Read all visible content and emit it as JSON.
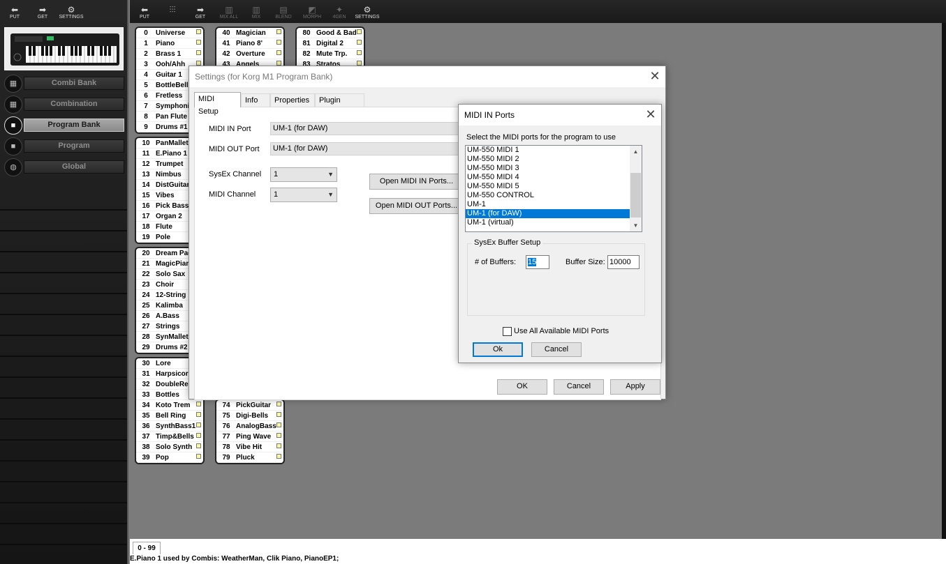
{
  "left_toolbar": {
    "put": "PUT",
    "get": "GET",
    "settings": "SETTINGS"
  },
  "top_toolbar": {
    "put": "PUT",
    "mix_icon": "sliders-icon",
    "get": "GET",
    "mix_all": "MIX ALL",
    "mix": "MIX",
    "blend": "BLEND",
    "morph": "MORPH",
    "4gen": "4GEN",
    "settings": "SETTINGS"
  },
  "nav": {
    "items": [
      {
        "label": "Combi Bank",
        "icon": "keyboard-grid-icon",
        "selected": false
      },
      {
        "label": "Combination",
        "icon": "keyboard-grid-icon",
        "selected": false
      },
      {
        "label": "Program Bank",
        "icon": "square-icon",
        "selected": true
      },
      {
        "label": "Program",
        "icon": "square-icon",
        "selected": false
      },
      {
        "label": "Global",
        "icon": "globe-icon",
        "selected": false
      }
    ]
  },
  "programs": {
    "col1": [
      [
        "0",
        "Universe"
      ],
      [
        "1",
        "Piano"
      ],
      [
        "2",
        "Brass 1"
      ],
      [
        "3",
        "Ooh/Ahh"
      ],
      [
        "4",
        "Guitar 1"
      ],
      [
        "5",
        "BottleBell"
      ],
      [
        "6",
        "Fretless"
      ],
      [
        "7",
        "Symphonic"
      ],
      [
        "8",
        "Pan Flute"
      ],
      [
        "9",
        "Drums #1"
      ],
      [
        "10",
        "PanMallet"
      ],
      [
        "11",
        "E.Piano 1"
      ],
      [
        "12",
        "Trumpet"
      ],
      [
        "13",
        "Nimbus"
      ],
      [
        "14",
        "DistGuitar"
      ],
      [
        "15",
        "Vibes"
      ],
      [
        "16",
        "Pick Bass"
      ],
      [
        "17",
        "Organ 2"
      ],
      [
        "18",
        "Flute"
      ],
      [
        "19",
        "Pole"
      ],
      [
        "20",
        "Dream Pad"
      ],
      [
        "21",
        "MagicPiano"
      ],
      [
        "22",
        "Solo Sax"
      ],
      [
        "23",
        "Choir"
      ],
      [
        "24",
        "12-String"
      ],
      [
        "25",
        "Kalimba"
      ],
      [
        "26",
        "A.Bass"
      ],
      [
        "27",
        "Strings"
      ],
      [
        "28",
        "SynMallet"
      ],
      [
        "29",
        "Drums #2"
      ],
      [
        "30",
        "Lore"
      ],
      [
        "31",
        "Harpsicord"
      ],
      [
        "32",
        "DoubleReed"
      ],
      [
        "33",
        "Bottles"
      ],
      [
        "34",
        "Koto Trem"
      ],
      [
        "35",
        "Bell Ring"
      ],
      [
        "36",
        "SynthBass1"
      ],
      [
        "37",
        "Timp&Bells"
      ],
      [
        "38",
        "Solo Synth"
      ],
      [
        "39",
        "Pop"
      ]
    ],
    "col2_top": [
      [
        "40",
        "Magician"
      ],
      [
        "41",
        "Piano 8'"
      ],
      [
        "42",
        "Overture"
      ],
      [
        "43",
        "Angels"
      ]
    ],
    "col2_bottom": [
      [
        "74",
        "PickGuitar"
      ],
      [
        "75",
        "Digi-Bells"
      ],
      [
        "76",
        "AnalogBass"
      ],
      [
        "77",
        "Ping Wave"
      ],
      [
        "78",
        "Vibe Hit"
      ],
      [
        "79",
        "Pluck"
      ]
    ],
    "col3_top": [
      [
        "80",
        "Good & Bad"
      ],
      [
        "81",
        "Digital 2"
      ],
      [
        "82",
        "Mute Trp."
      ],
      [
        "83",
        "Stratos"
      ]
    ]
  },
  "status": {
    "range_tab": "0 - 99",
    "message": "E.Piano 1 used by Combis: WeatherMan, Clik Piano, PianoEP1;"
  },
  "settings_dialog": {
    "title": "Settings (for Korg M1 Program Bank)",
    "tabs": [
      "MIDI Setup",
      "Info",
      "Properties",
      "Plugin Setup"
    ],
    "midi_in_port_label": "MIDI IN Port",
    "midi_in_port_value": "UM-1 (for DAW)",
    "midi_out_port_label": "MIDI OUT Port",
    "midi_out_port_value": "UM-1 (for DAW)",
    "sysex_channel_label": "SysEx Channel",
    "sysex_channel_value": "1",
    "midi_channel_label": "MIDI Channel",
    "midi_channel_value": "1",
    "open_in_button": "Open MIDI IN Ports...",
    "open_out_button": "Open MIDI OUT Ports...",
    "ok": "OK",
    "cancel": "Cancel",
    "apply": "Apply"
  },
  "ports_dialog": {
    "title": "MIDI IN Ports",
    "instruction": "Select the MIDI ports for the program to use",
    "ports": [
      "UM-550 MIDI 1",
      "UM-550 MIDI 2",
      "UM-550 MIDI 3",
      "UM-550 MIDI 4",
      "UM-550 MIDI 5",
      "UM-550 CONTROL",
      "UM-1",
      "UM-1 (for DAW)",
      "UM-1 (virtual)"
    ],
    "selected_port": "UM-1 (for DAW)",
    "sysex_group_label": "SysEx Buffer Setup",
    "buffers_label": "# of Buffers:",
    "buffers_value": "15",
    "buffer_size_label": "Buffer Size:",
    "buffer_size_value": "10000",
    "use_all_label": "Use All Available MIDI Ports",
    "ok": "Ok",
    "cancel": "Cancel"
  }
}
